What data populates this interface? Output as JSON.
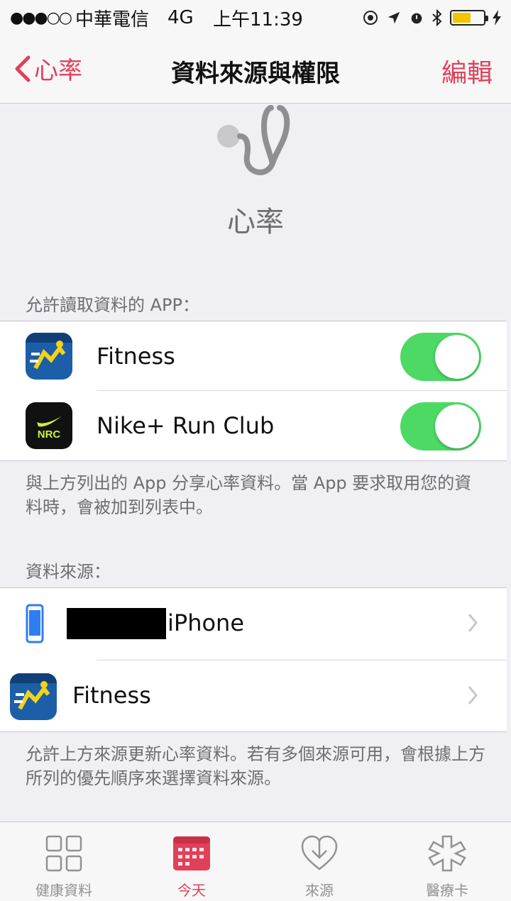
{
  "status_bar": {
    "signal": "●●●○○",
    "carrier": "中華電信",
    "network": "4G",
    "time": "上午11:39",
    "icons": [
      "location-lock-icon",
      "location-arrow-icon",
      "alarm-icon",
      "bluetooth-icon",
      "battery-icon",
      "charging-icon"
    ],
    "battery_level": 0.6
  },
  "nav": {
    "back_label": "心率",
    "title": "資料來源與權限",
    "edit_label": "編輯"
  },
  "header": {
    "icon": "stethoscope-icon",
    "title": "心率"
  },
  "read_section": {
    "header": "允許讀取資料的 APP：",
    "apps": [
      {
        "name": "Fitness",
        "icon": "wahoo-fitness-icon",
        "enabled": true
      },
      {
        "name": "Nike+ Run Club",
        "icon": "nike-nrc-icon",
        "enabled": true
      }
    ],
    "footer": "與上方列出的 App 分享心率資料。當 App 要求取用您的資料時，會被加到列表中。"
  },
  "sources_section": {
    "header": "資料來源：",
    "sources": [
      {
        "name": "iPhone",
        "icon": "iphone-icon"
      },
      {
        "name": "Fitness",
        "icon": "wahoo-fitness-icon"
      }
    ],
    "footer": "允許上方來源更新心率資料。若有多個來源可用，會根據上方所列的優先順序來選擇資料來源。"
  },
  "tabs": [
    {
      "label": "健康資料",
      "icon": "grid-icon",
      "active": false
    },
    {
      "label": "今天",
      "icon": "calendar-icon",
      "active": true
    },
    {
      "label": "來源",
      "icon": "heart-download-icon",
      "active": false
    },
    {
      "label": "醫療卡",
      "icon": "medical-star-icon",
      "active": false
    }
  ],
  "colors": {
    "accent": "#e0405a",
    "toggle_on": "#4cd964",
    "background": "#efeff4"
  }
}
